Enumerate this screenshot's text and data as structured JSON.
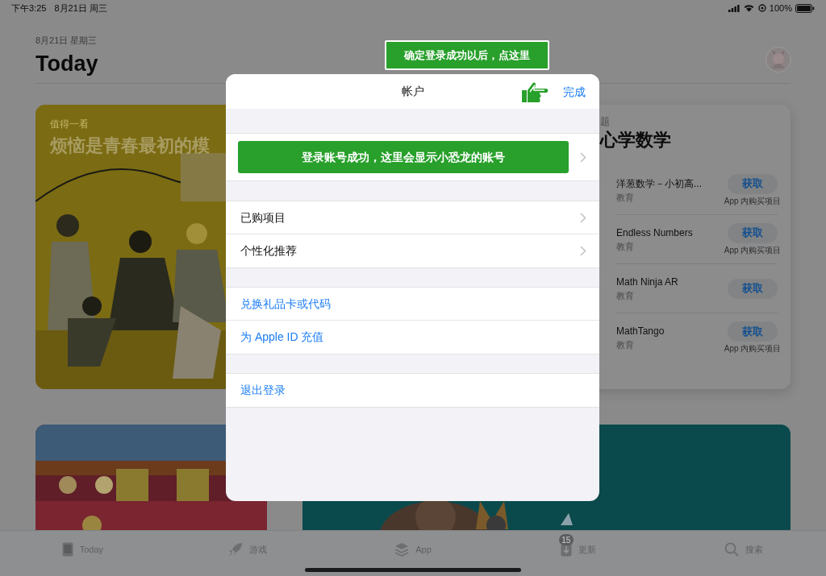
{
  "status_bar": {
    "time": "下午3:25",
    "date": "8月21日 周三",
    "battery": "100%"
  },
  "header": {
    "date": "8月21日 星期三",
    "title": "Today"
  },
  "featured_card": {
    "eyebrow": "值得一看",
    "title": "烦恼是青春最初的模"
  },
  "collection_card": {
    "eyebrow": "题",
    "title": "心学数学",
    "apps": [
      {
        "name": "洋葱数学－小初高...",
        "category": "教育",
        "button": "获取",
        "note": "App 内购买项目"
      },
      {
        "name": "Endless Numbers",
        "category": "教育",
        "button": "获取",
        "note": "App 内购买项目"
      },
      {
        "name": "Math Ninja AR",
        "category": "教育",
        "button": "获取"
      },
      {
        "name": "MathTango",
        "category": "教育",
        "button": "获取",
        "note": "App 内购买项目"
      }
    ]
  },
  "tab_bar": [
    {
      "label": "Today"
    },
    {
      "label": "游戏"
    },
    {
      "label": "App"
    },
    {
      "label": "更新",
      "badge": "15"
    },
    {
      "label": "搜索"
    }
  ],
  "account_sheet": {
    "title": "帐户",
    "done": "完成",
    "tooltip": "确定登录成功以后，点这里",
    "account_banner": "登录账号成功，这里会显示小恐龙的账号",
    "sections": [
      [
        {
          "label": "已购项目",
          "kind": "nav"
        },
        {
          "label": "个性化推荐",
          "kind": "nav"
        }
      ],
      [
        {
          "label": "兑换礼品卡或代码",
          "kind": "action"
        },
        {
          "label": "为 Apple ID 充值",
          "kind": "action"
        }
      ],
      [
        {
          "label": "退出登录",
          "kind": "action"
        }
      ]
    ]
  }
}
